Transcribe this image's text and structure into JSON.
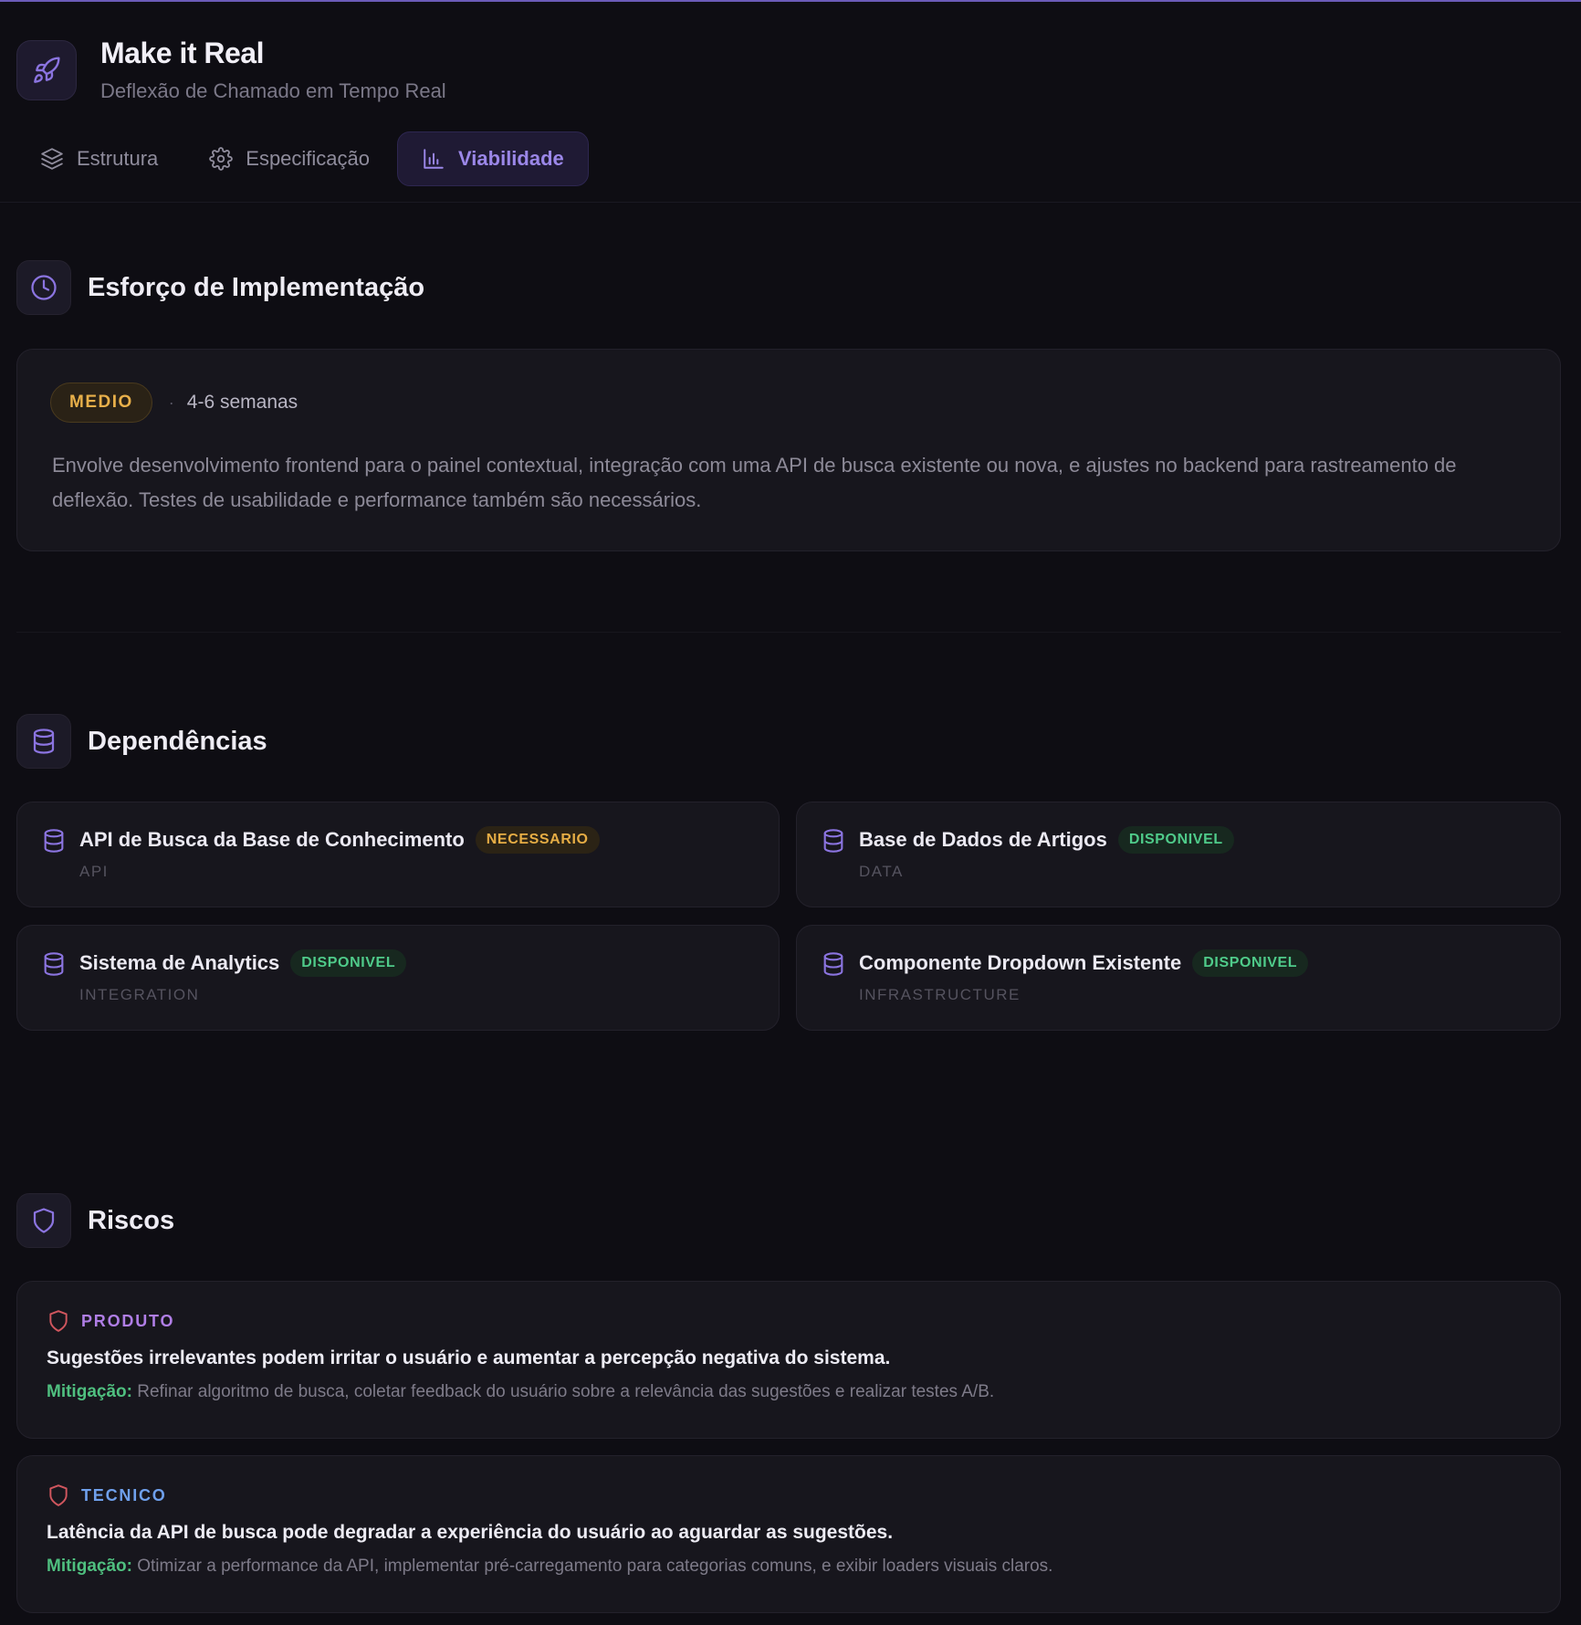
{
  "app": {
    "title": "Make it Real",
    "subtitle": "Deflexão de Chamado em Tempo Real"
  },
  "tabs": [
    {
      "label": "Estrutura",
      "icon": "layers-icon",
      "active": false
    },
    {
      "label": "Especificação",
      "icon": "gear-icon",
      "active": false
    },
    {
      "label": "Viabilidade",
      "icon": "bar-chart-icon",
      "active": true
    }
  ],
  "effort": {
    "title": "Esforço de Implementação",
    "level": "MEDIO",
    "separator": "·",
    "duration": "4-6 semanas",
    "description": "Envolve desenvolvimento frontend para o painel contextual, integração com uma API de busca existente ou nova, e ajustes no backend para rastreamento de deflexão. Testes de usabilidade e performance também são necessários."
  },
  "dependencies": {
    "title": "Dependências",
    "items": [
      {
        "name": "API de Busca da Base de Conhecimento",
        "status": "NECESSARIO",
        "type": "API"
      },
      {
        "name": "Base de Dados de Artigos",
        "status": "DISPONIVEL",
        "type": "DATA"
      },
      {
        "name": "Sistema de Analytics",
        "status": "DISPONIVEL",
        "type": "INTEGRATION"
      },
      {
        "name": "Componente Dropdown Existente",
        "status": "DISPONIVEL",
        "type": "INFRASTRUCTURE"
      }
    ]
  },
  "risks": {
    "title": "Riscos",
    "mitigation_label": "Mitigação:",
    "items": [
      {
        "category": "PRODUTO",
        "category_color": "#b07ee6",
        "title": "Sugestões irrelevantes podem irritar o usuário e aumentar a percepção negativa do sistema.",
        "mitigation": "Refinar algoritmo de busca, coletar feedback do usuário sobre a relevância das sugestões e realizar testes A/B."
      },
      {
        "category": "TECNICO",
        "category_color": "#6fa0ec",
        "title": "Latência da API de busca pode degradar a experiência do usuário ao aguardar as sugestões.",
        "mitigation": "Otimizar a performance da API, implementar pré-carregamento para categorias comuns, e exibir loaders visuais claros."
      }
    ]
  },
  "colors": {
    "accent": "#8b74e0",
    "background": "#0e0d13",
    "warning": "#e8b04a",
    "success": "#4fcb8a",
    "risk_icon": "#d0565e"
  }
}
